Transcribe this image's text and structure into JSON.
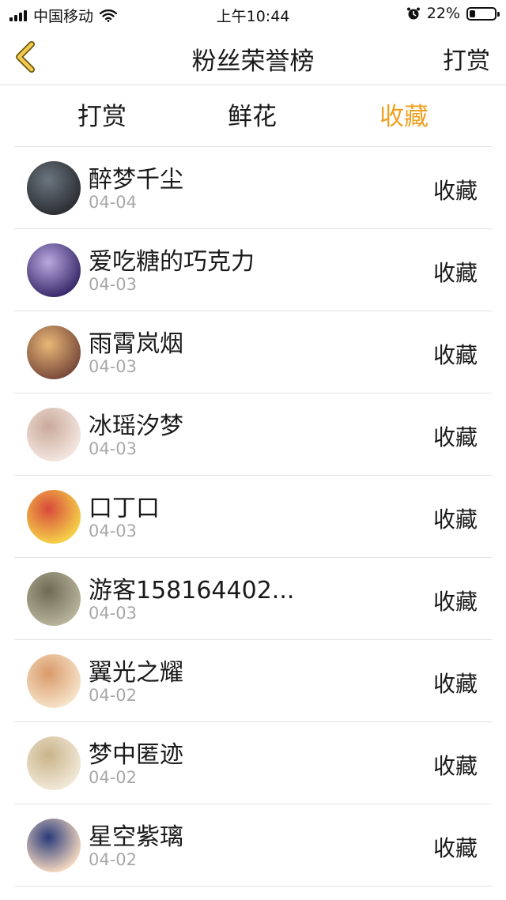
{
  "status_bar": {
    "carrier": "中国移动",
    "time": "上午10:44",
    "battery": "22%",
    "battery_level": 0.22
  },
  "nav": {
    "title": "粉丝荣誉榜",
    "right_action": "打赏",
    "back_icon": "chevron-left-icon",
    "accent_color": "#f0a020"
  },
  "tabs": [
    {
      "label": "打赏",
      "active": false
    },
    {
      "label": "鲜花",
      "active": false
    },
    {
      "label": "收藏",
      "active": true
    }
  ],
  "fans": [
    {
      "name": "醉梦千尘",
      "date": "04-04",
      "action": "收藏",
      "avatar_colors": [
        "#2b2e33",
        "#6b7580"
      ]
    },
    {
      "name": "爱吃糖的巧克力",
      "date": "04-03",
      "action": "收藏",
      "avatar_colors": [
        "#3a2a6a",
        "#b9a8e0"
      ]
    },
    {
      "name": "雨霄岚烟",
      "date": "04-03",
      "action": "收藏",
      "avatar_colors": [
        "#7a4a3a",
        "#e8b878"
      ]
    },
    {
      "name": "冰瑶汐梦",
      "date": "04-03",
      "action": "收藏",
      "avatar_colors": [
        "#f3e6e0",
        "#caa99a"
      ]
    },
    {
      "name": "口丁口",
      "date": "04-03",
      "action": "收藏",
      "avatar_colors": [
        "#f6d24a",
        "#d84a3a"
      ]
    },
    {
      "name": "游客158164402...",
      "date": "04-03",
      "action": "收藏",
      "avatar_colors": [
        "#b8b39a",
        "#6e6a55"
      ]
    },
    {
      "name": "翼光之耀",
      "date": "04-02",
      "action": "收藏",
      "avatar_colors": [
        "#f6e3c8",
        "#d99a6a"
      ]
    },
    {
      "name": "梦中匿迹",
      "date": "04-02",
      "action": "收藏",
      "avatar_colors": [
        "#f1e8d8",
        "#c9b48a"
      ]
    },
    {
      "name": "星空紫璃",
      "date": "04-02",
      "action": "收藏",
      "avatar_colors": [
        "#f5d9c0",
        "#2a3a7a"
      ]
    }
  ]
}
